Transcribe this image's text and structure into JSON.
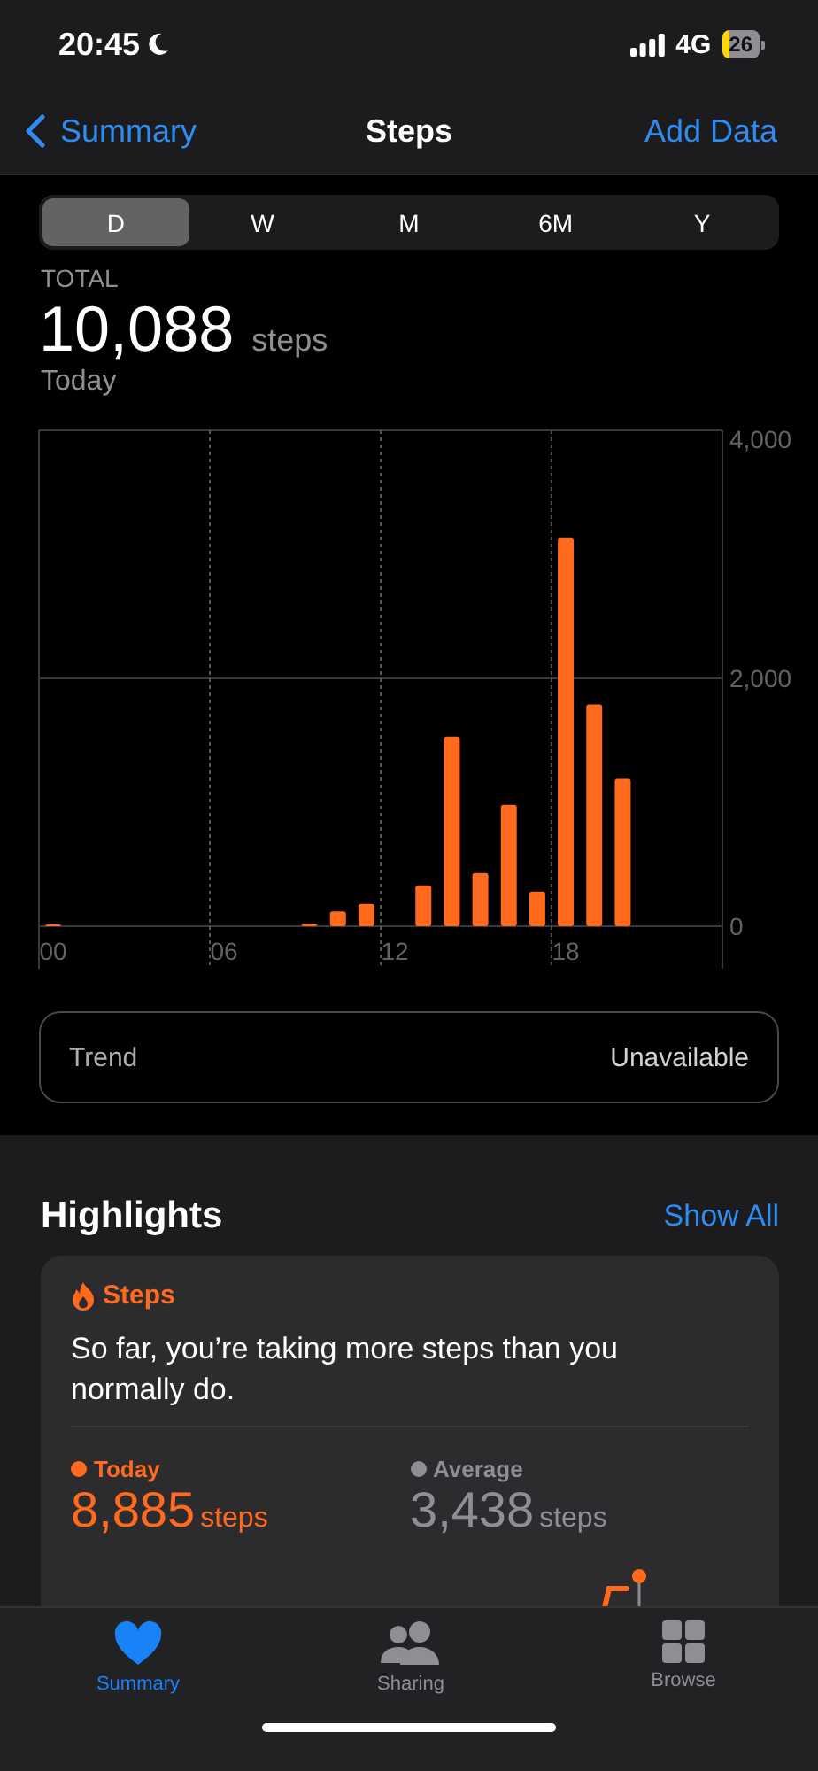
{
  "status_bar": {
    "time": "20:45",
    "network": "4G",
    "battery": "26"
  },
  "nav": {
    "back": "Summary",
    "title": "Steps",
    "action": "Add Data"
  },
  "range_tabs": [
    {
      "label": "D",
      "selected": true
    },
    {
      "label": "W",
      "selected": false
    },
    {
      "label": "M",
      "selected": false
    },
    {
      "label": "6M",
      "selected": false
    },
    {
      "label": "Y",
      "selected": false
    }
  ],
  "summary": {
    "label": "TOTAL",
    "value": "10,088",
    "unit": "steps",
    "period": "Today"
  },
  "chart_data": {
    "type": "bar",
    "x": [
      0,
      9,
      10,
      11,
      13,
      14,
      15,
      16,
      17,
      18,
      19,
      20
    ],
    "series": [
      {
        "color": "#ff6a1f",
        "values": [
          10,
          20,
          120,
          180,
          330,
          1530,
          430,
          980,
          280,
          3130,
          1790,
          1190
        ]
      }
    ],
    "xlim": [
      -0.5,
      23.5
    ],
    "ylim": [
      0,
      4000
    ],
    "xticks": [
      {
        "value": 0,
        "label": "00"
      },
      {
        "value": 6,
        "label": "06"
      },
      {
        "value": 12,
        "label": "12"
      },
      {
        "value": 18,
        "label": "18"
      }
    ],
    "yticks": [
      {
        "value": 0,
        "label": "0"
      },
      {
        "value": 2000,
        "label": "2,000"
      },
      {
        "value": 4000,
        "label": "4,000"
      }
    ]
  },
  "trend": {
    "label": "Trend",
    "value": "Unavailable"
  },
  "highlights": {
    "title": "Highlights",
    "action": "Show All",
    "card": {
      "title": "Steps",
      "message": "So far, you’re taking more steps than you normally do.",
      "stats": [
        {
          "label": "Today",
          "value": "8,885",
          "unit": "steps",
          "color": "#ff6a1f"
        },
        {
          "label": "Average",
          "value": "3,438",
          "unit": "steps",
          "color": "#8e8e93"
        }
      ]
    }
  },
  "tab_bar": [
    {
      "label": "Summary",
      "selected": true
    },
    {
      "label": "Sharing",
      "selected": false
    },
    {
      "label": "Browse",
      "selected": false
    }
  ]
}
